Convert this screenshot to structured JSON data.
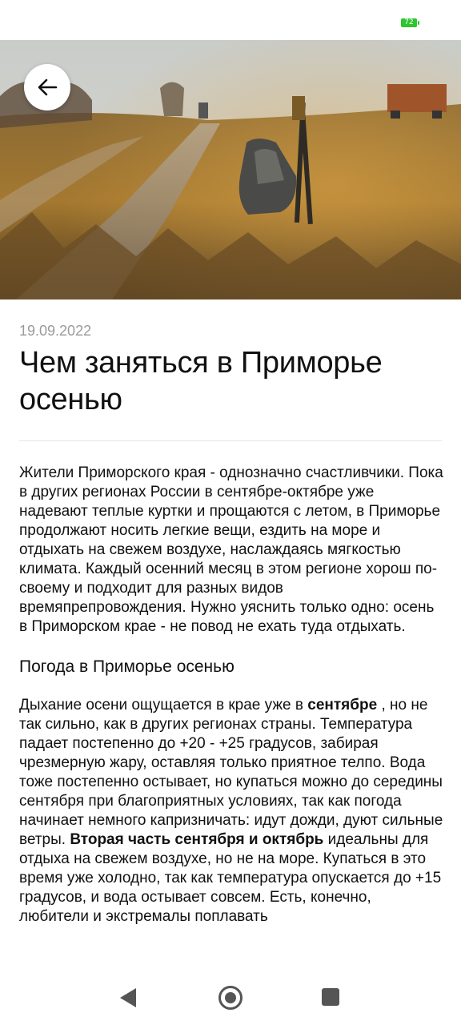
{
  "status_bar": {
    "battery_level": "72",
    "battery_color": "#2ec52e"
  },
  "hero": {
    "icon": "back-arrow-icon"
  },
  "article": {
    "date": "19.09.2022",
    "title": "Чем заняться в Приморье осенью",
    "intro": "Жители Приморского края - однозначно счастливчики. Пока в других регионах России в сентябре-октябре уже надевают теплые куртки и прощаются с летом, в Приморье продолжают носить легкие вещи, ездить на море и отдыхать на свежем воздухе, наслаждаясь мягкостью климата. Каждый осенний месяц в этом регионе хорош по-своему и подходит для разных видов времяпрепровождения. Нужно уяснить только одно: осень в Приморском крае - не повод не ехать туда отдыхать.",
    "section_heading": "Погода в Приморье осенью",
    "section": {
      "part1": "Дыхание осени ощущается в крае уже в ",
      "bold1": "сентябре",
      "part2": " , но не так сильно, как в других регионах страны. Температура падает постепенно до +20 - +25 градусов, забирая чрезмерную жару, оставляя только приятное телпо. Вода тоже постепенно остывает, но купаться можно до середины сентября при благоприятных условиях, так как погода начинает немного капризничать: идут дожди, дуют сильные ветры. ",
      "bold2": "Вторая часть сентября и октябрь",
      "part3": "  идеальны для отдыха на свежем воздухе, но не на море. Купаться в это время уже холодно, так как температура опускается до +15 градусов, и вода остывает совсем. Есть, конечно, любители и экстремалы поплавать"
    }
  },
  "nav_bar": {
    "back_icon": "triangle-back-icon",
    "home_icon": "circle-home-icon",
    "recent_icon": "square-recents-icon"
  }
}
